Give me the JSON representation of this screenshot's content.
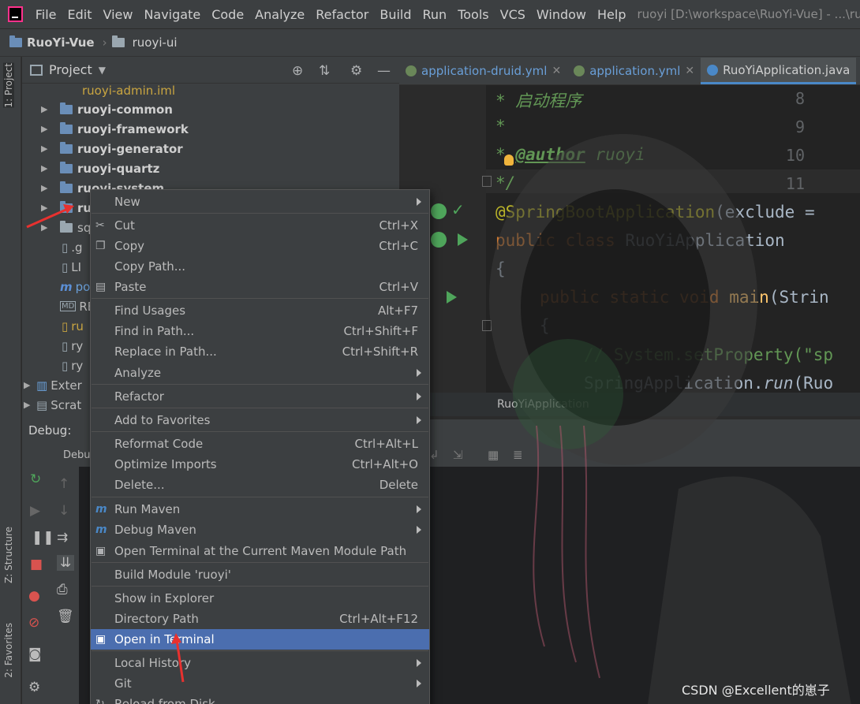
{
  "menubar": {
    "items": [
      "File",
      "Edit",
      "View",
      "Navigate",
      "Code",
      "Analyze",
      "Refactor",
      "Build",
      "Run",
      "Tools",
      "VCS",
      "Window",
      "Help"
    ],
    "window_title": "ruoyi [D:\\workspace\\RuoYi-Vue] - ...\\ruoyi"
  },
  "breadcrumb": {
    "project": "RuoYi-Vue",
    "module": "ruoyi-ui"
  },
  "left_stripe": {
    "project_tab": "1: Project",
    "structure_tab": "Z: Structure",
    "favorites_tab": "2: Favorites"
  },
  "project_panel": {
    "title": "Project",
    "tree": [
      {
        "label": "ruoyi-admin.iml",
        "style": "yellow"
      },
      {
        "label": "ruoyi-common",
        "style": "bold"
      },
      {
        "label": "ruoyi-framework",
        "style": "bold"
      },
      {
        "label": "ruoyi-generator",
        "style": "bold"
      },
      {
        "label": "ruoyi-quartz",
        "style": "bold"
      },
      {
        "label": "ruoyi-system",
        "style": "bold"
      },
      {
        "label": "ru",
        "style": "bold"
      },
      {
        "label": "sq",
        "style": "normal"
      },
      {
        "label": ".g",
        "style": "normal"
      },
      {
        "label": "LI",
        "style": "normal"
      },
      {
        "label": "po",
        "style": "normal"
      },
      {
        "label": "RE",
        "style": "normal"
      },
      {
        "label": "ru",
        "style": "yellow"
      },
      {
        "label": "ry",
        "style": "normal"
      },
      {
        "label": "ry",
        "style": "normal"
      },
      {
        "label": "Exter",
        "style": "normal"
      },
      {
        "label": "Scrat",
        "style": "normal"
      }
    ]
  },
  "editor": {
    "tabs": [
      {
        "label": "application-druid.yml"
      },
      {
        "label": "application.yml"
      },
      {
        "label": "RuoYiApplication.java"
      }
    ],
    "line_numbers": [
      "8",
      "9",
      "10",
      "11"
    ],
    "lines": {
      "l8": "* 启动程序",
      "l9": "*",
      "l10_star": "*",
      "l10_tag": "@author",
      "l10_val": "ruoyi",
      "l11": "*/",
      "l12_ann": "@SpringBootApplication",
      "l12_rest": "(exclude =",
      "l13_kw": "public class",
      "l13_name": "RuoYiApplication",
      "l14": "{",
      "l15_kw": "public static void",
      "l15_fn": "main",
      "l15_rest": "(Strin",
      "l16": "{",
      "l17_cmt": "// System.setProperty(\"sp",
      "l18_a": "SpringApplication.",
      "l18_b": "run",
      "l18_c": "(Ruo"
    },
    "status_crumb": "RuoYiApplication"
  },
  "debug": {
    "label": "Debug:",
    "tab": "Debu"
  },
  "context_menu": {
    "items": [
      {
        "label": "New",
        "shortcut": "",
        "submenu": true,
        "icon": ""
      },
      {
        "label": "Cut",
        "shortcut": "Ctrl+X",
        "submenu": false,
        "icon": "scissors-icon"
      },
      {
        "label": "Copy",
        "shortcut": "Ctrl+C",
        "submenu": false,
        "icon": "copy-icon"
      },
      {
        "label": "Copy Path...",
        "shortcut": "",
        "submenu": false,
        "icon": ""
      },
      {
        "label": "Paste",
        "shortcut": "Ctrl+V",
        "submenu": false,
        "icon": "paste-icon"
      },
      {
        "label": "Find Usages",
        "shortcut": "Alt+F7",
        "submenu": false,
        "icon": ""
      },
      {
        "label": "Find in Path...",
        "shortcut": "Ctrl+Shift+F",
        "submenu": false,
        "icon": ""
      },
      {
        "label": "Replace in Path...",
        "shortcut": "Ctrl+Shift+R",
        "submenu": false,
        "icon": ""
      },
      {
        "label": "Analyze",
        "shortcut": "",
        "submenu": true,
        "icon": ""
      },
      {
        "label": "Refactor",
        "shortcut": "",
        "submenu": true,
        "icon": ""
      },
      {
        "label": "Add to Favorites",
        "shortcut": "",
        "submenu": true,
        "icon": ""
      },
      {
        "label": "Reformat Code",
        "shortcut": "Ctrl+Alt+L",
        "submenu": false,
        "icon": ""
      },
      {
        "label": "Optimize Imports",
        "shortcut": "Ctrl+Alt+O",
        "submenu": false,
        "icon": ""
      },
      {
        "label": "Delete...",
        "shortcut": "Delete",
        "submenu": false,
        "icon": ""
      },
      {
        "label": "Run Maven",
        "shortcut": "",
        "submenu": true,
        "icon": "maven-icon"
      },
      {
        "label": "Debug Maven",
        "shortcut": "",
        "submenu": true,
        "icon": "maven-debug-icon"
      },
      {
        "label": "Open Terminal at the Current Maven Module Path",
        "shortcut": "",
        "submenu": false,
        "icon": "maven-terminal-icon"
      },
      {
        "label": "Build Module 'ruoyi'",
        "shortcut": "",
        "submenu": false,
        "icon": ""
      },
      {
        "label": "Show in Explorer",
        "shortcut": "",
        "submenu": false,
        "icon": ""
      },
      {
        "label": "Directory Path",
        "shortcut": "Ctrl+Alt+F12",
        "submenu": false,
        "icon": ""
      },
      {
        "label": "Open in Terminal",
        "shortcut": "",
        "submenu": false,
        "icon": "terminal-icon",
        "selected": true
      },
      {
        "label": "Local History",
        "shortcut": "",
        "submenu": true,
        "icon": ""
      },
      {
        "label": "Git",
        "shortcut": "",
        "submenu": true,
        "icon": ""
      },
      {
        "label": "Reload from Disk",
        "shortcut": "",
        "submenu": false,
        "icon": "reload-icon"
      }
    ]
  },
  "watermark": "CSDN @Excellent的崽子",
  "colors": {
    "menu_bg": "#3c3f41",
    "selection": "#4b6eaf",
    "editor_bg": "#2b2b2b",
    "annotation_arrow": "#e8312f"
  }
}
